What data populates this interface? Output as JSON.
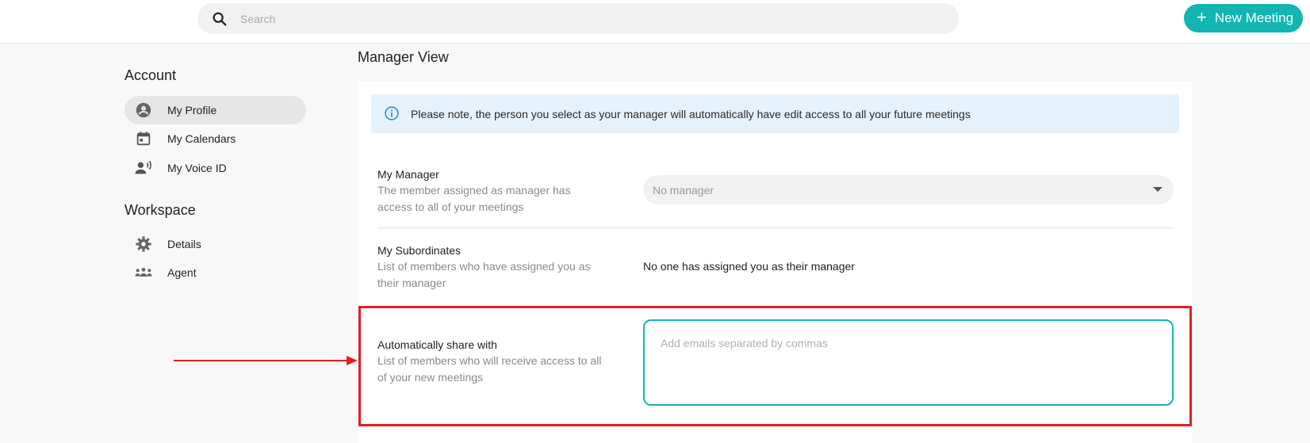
{
  "header": {
    "search_placeholder": "Search",
    "new_meeting_label": "New Meeting",
    "accent_color": "#13b5b1"
  },
  "sidebar": {
    "account_heading": "Account",
    "account_items": [
      {
        "label": "My Profile",
        "icon": "account-circle-icon",
        "active": true
      },
      {
        "label": "My Calendars",
        "icon": "calendar-icon",
        "active": false
      },
      {
        "label": "My Voice ID",
        "icon": "voice-id-icon",
        "active": false
      }
    ],
    "workspace_heading": "Workspace",
    "workspace_items": [
      {
        "label": "Details",
        "icon": "gear-icon"
      },
      {
        "label": "Agent",
        "icon": "people-group-icon"
      }
    ]
  },
  "main": {
    "section_title": "Manager View",
    "notice_text": "Please note, the person you select as your manager will automatically have edit access to all your future meetings",
    "manager": {
      "title": "My Manager",
      "description": "The member assigned as manager has access to all of your meetings",
      "select_value": "No manager"
    },
    "subordinates": {
      "title": "My Subordinates",
      "description": "List of members who have assigned you as their manager",
      "value": "No one has assigned you as their manager"
    },
    "auto_share": {
      "title": "Automatically share with",
      "description": "List of members who will receive access to all of your new meetings",
      "placeholder": "Add emails separated by commas"
    }
  },
  "annotation": {
    "highlight_color": "#e31e24"
  }
}
